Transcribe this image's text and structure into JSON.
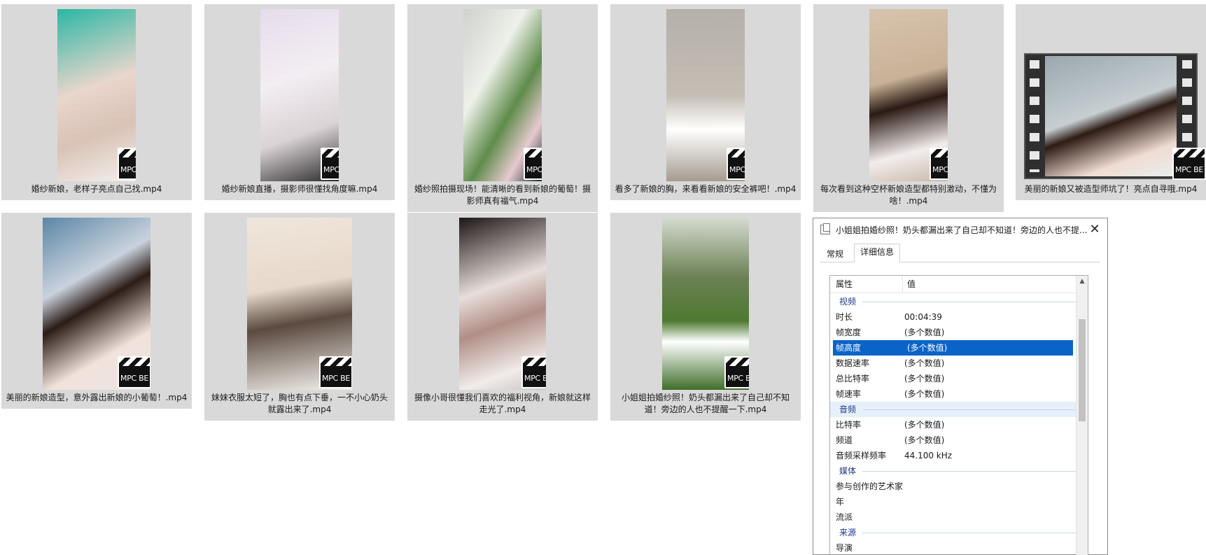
{
  "badge_text": "MPC BE",
  "files": [
    {
      "caption": "婚纱新娘，老样子亮点自己找.mp4"
    },
    {
      "caption": "婚纱新娘直播，摄影师很懂找角度嘛.mp4"
    },
    {
      "caption": "婚纱照拍摄现场！能清晰的看到新娘的葡萄！摄影师真有福气.mp4"
    },
    {
      "caption": "看多了新娘的胸，来看看新娘的安全裤吧！.mp4"
    },
    {
      "caption": "每次看到这种空杯新娘造型都特别激动，不懂为啥！.mp4"
    },
    {
      "caption": "美丽的新娘又被造型师坑了！亮点自寻哦.mp4"
    },
    {
      "caption": "美丽的新娘造型，意外露出新娘的小葡萄！.mp4"
    },
    {
      "caption": "妹妹衣服太短了，胸也有点下垂，一不小心奶头就露出来了.mp4"
    },
    {
      "caption": "摄像小哥很懂我们喜欢的福利视角，新娘就这样走光了.mp4"
    },
    {
      "caption": "小姐姐拍婚纱照！奶头都漏出来了自己却不知道！旁边的人也不提醒一下.mp4"
    }
  ],
  "dialog": {
    "title": "小姐姐拍婚纱照！奶头都漏出来了自己却不知道！旁边的人也不提...",
    "close_glyph": "✕",
    "tabs": [
      "常规",
      "详细信息"
    ],
    "header": {
      "col1": "属性",
      "col2": "值"
    },
    "groups": {
      "video": "视频",
      "audio": "音频",
      "media": "媒体",
      "source": "来源"
    },
    "video_rows": [
      {
        "key": "时长",
        "value": "00:04:39"
      },
      {
        "key": "帧宽度",
        "value": "(多个数值)"
      },
      {
        "key": "帧高度",
        "value": "(多个数值)"
      },
      {
        "key": "数据速率",
        "value": "(多个数值)"
      },
      {
        "key": "总比特率",
        "value": "(多个数值)"
      },
      {
        "key": "帧速率",
        "value": "(多个数值)"
      }
    ],
    "audio_rows": [
      {
        "key": "比特率",
        "value": "(多个数值)"
      },
      {
        "key": "频道",
        "value": "(多个数值)"
      },
      {
        "key": "音频采样频率",
        "value": "44.100 kHz"
      }
    ],
    "media_rows": [
      {
        "key": "参与创作的艺术家",
        "value": ""
      },
      {
        "key": "年",
        "value": ""
      },
      {
        "key": "流派",
        "value": ""
      }
    ],
    "source_rows": [
      {
        "key": "导演",
        "value": ""
      }
    ],
    "scroll_up_glyph": "▲"
  }
}
